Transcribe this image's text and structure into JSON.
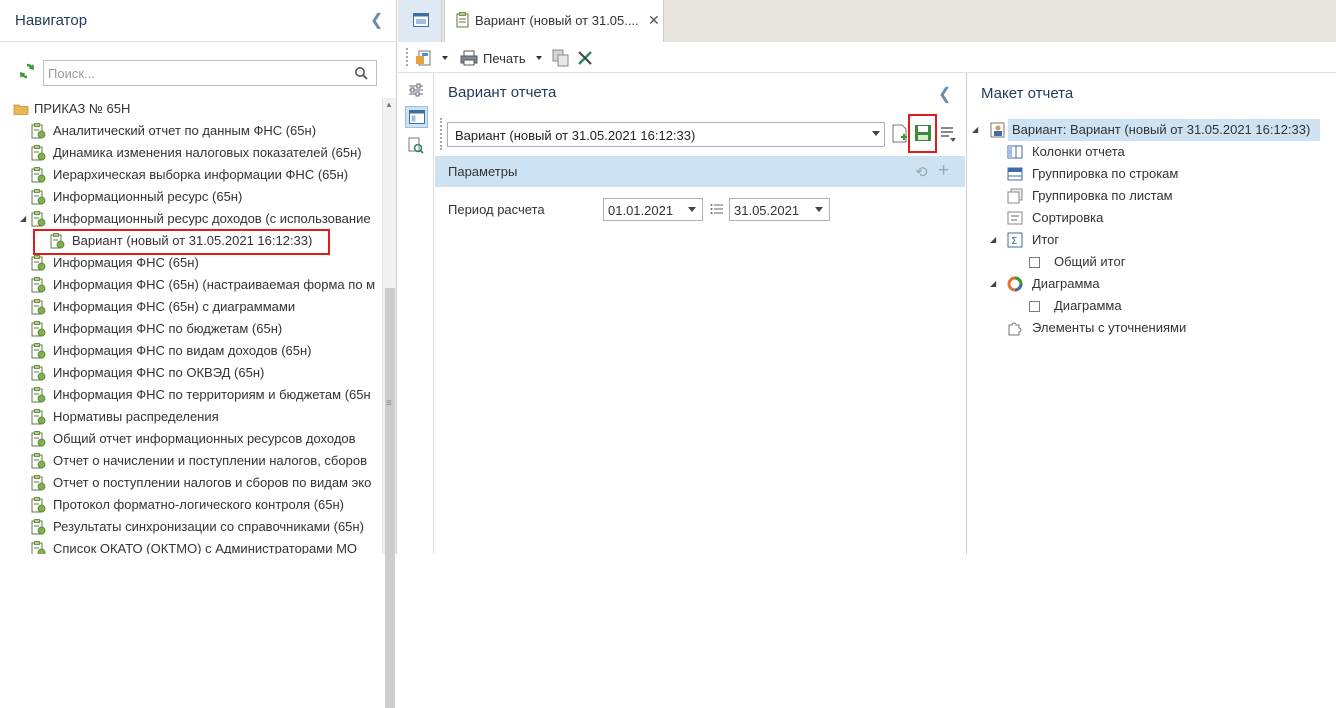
{
  "navigator": {
    "title": "Навигатор",
    "search_placeholder": "Поиск...",
    "root_label": "ПРИКАЗ № 65Н",
    "items": [
      "Аналитический отчет по данным ФНС (65н)",
      "Динамика изменения налоговых показателей (65н)",
      "Иерархическая выборка информации ФНС (65н)",
      "Информационный ресурс (65н)",
      "Информационный ресурс доходов (с использование",
      "Вариант (новый от 31.05.2021 16:12:33)",
      "Информация ФНС (65н)",
      "Информация ФНС (65н) (настраиваемая форма по м",
      "Информация ФНС (65н) с диаграммами",
      "Информация ФНС по бюджетам (65н)",
      "Информация ФНС по видам доходов (65н)",
      "Информация ФНС по ОКВЭД (65н)",
      "Информация ФНС по территориям и бюджетам (65н",
      "Нормативы распределения",
      "Общий отчет информационных ресурсов доходов",
      "Отчет о начислении и поступлении налогов, сборов",
      "Отчет о поступлении налогов и сборов по видам эко",
      "Протокол форматно-логического контроля (65н)",
      "Результаты синхронизации со справочниками (65н)",
      "Список ОКАТО (ОКТМО) с Администраторами МО"
    ]
  },
  "tabs": {
    "active_label": "Вариант (новый от 31.05...."
  },
  "toolbar": {
    "print_label": "Печать"
  },
  "variant_panel": {
    "title": "Вариант отчета",
    "selected_variant": "Вариант (новый от 31.05.2021 16:12:33)",
    "params_label": "Параметры",
    "period_label": "Период расчета",
    "date_from": "01.01.2021",
    "date_to": "31.05.2021"
  },
  "layout_panel": {
    "title": "Макет отчета",
    "root": "Вариант: Вариант (новый от 31.05.2021 16:12:33)",
    "columns": "Колонки отчета",
    "group_rows": "Группировка по строкам",
    "group_sheets": "Группировка по листам",
    "sort": "Сортировка",
    "total": "Итог",
    "total_general": "Общий итог",
    "chart": "Диаграмма",
    "chart_child": "Диаграмма",
    "refinements": "Элементы с уточнениями"
  }
}
